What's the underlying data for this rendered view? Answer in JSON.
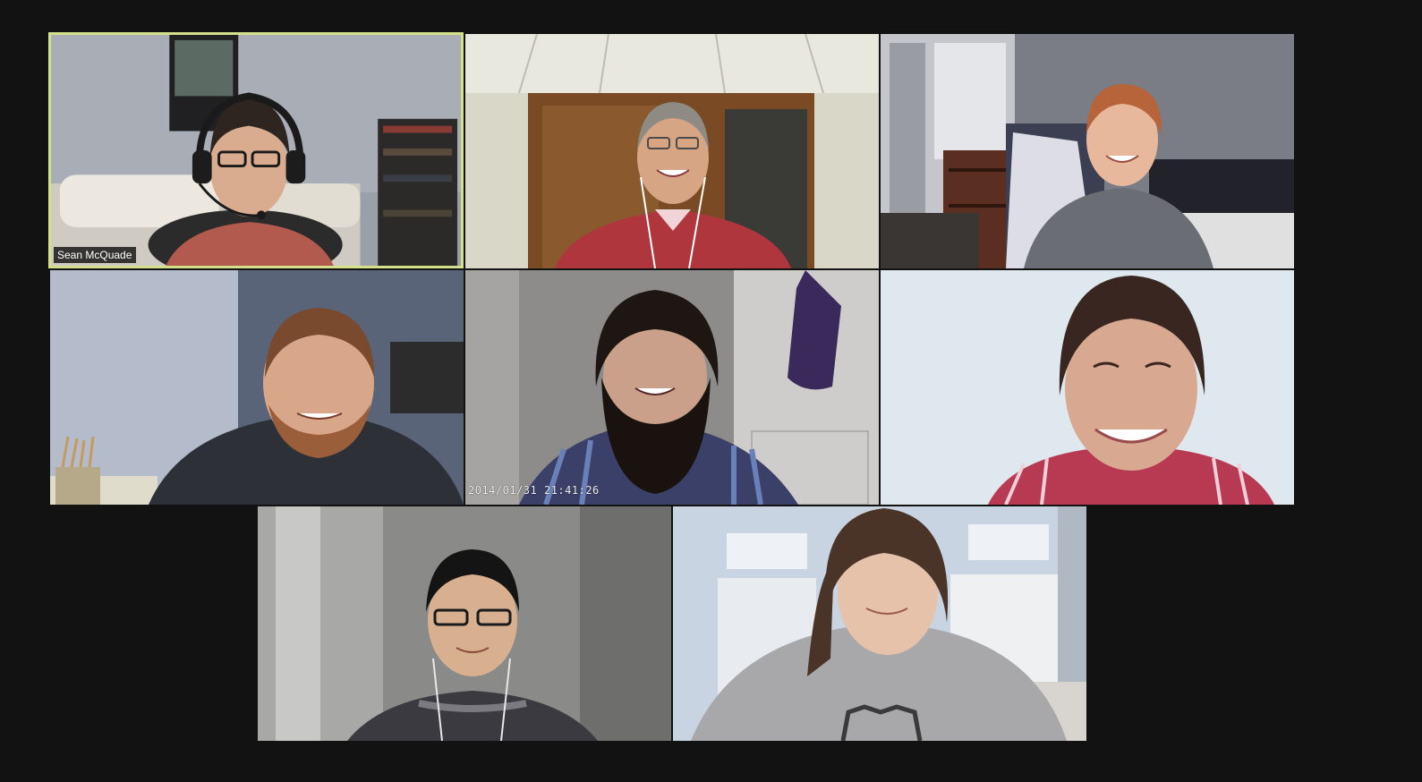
{
  "meeting": {
    "participants": [
      {
        "id": "p1",
        "name_label": "Sean McQuade",
        "active_speaker": true
      },
      {
        "id": "p2"
      },
      {
        "id": "p3"
      },
      {
        "id": "p4"
      },
      {
        "id": "p5",
        "overlay_text": "2014/01/31 21:41:26"
      },
      {
        "id": "p6"
      },
      {
        "id": "p7"
      },
      {
        "id": "p8"
      }
    ],
    "colors": {
      "background": "#121212",
      "active_speaker_border": "#d4e08a"
    }
  }
}
